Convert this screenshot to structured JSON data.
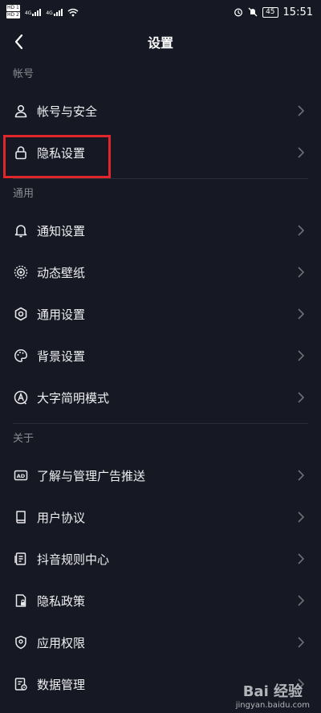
{
  "status_bar": {
    "left_badges": [
      "HD 1",
      "HD 2"
    ],
    "net_labels": [
      "4G",
      "4G"
    ],
    "battery": "45",
    "time": "15:51"
  },
  "header": {
    "title": "设置"
  },
  "sections": {
    "account": {
      "label": "帐号",
      "items": [
        {
          "label": "帐号与安全",
          "icon": "user-icon"
        },
        {
          "label": "隐私设置",
          "icon": "lock-icon"
        }
      ]
    },
    "general": {
      "label": "通用",
      "items": [
        {
          "label": "通知设置",
          "icon": "bell-icon"
        },
        {
          "label": "动态壁纸",
          "icon": "live-wallpaper-icon"
        },
        {
          "label": "通用设置",
          "icon": "gear-icon"
        },
        {
          "label": "背景设置",
          "icon": "palette-icon"
        },
        {
          "label": "大字简明模式",
          "icon": "large-font-icon"
        }
      ]
    },
    "about": {
      "label": "关于",
      "items": [
        {
          "label": "了解与管理广告推送",
          "icon": "ad-icon"
        },
        {
          "label": "用户协议",
          "icon": "book-icon"
        },
        {
          "label": "抖音规则中心",
          "icon": "document-list-icon"
        },
        {
          "label": "隐私政策",
          "icon": "privacy-doc-icon"
        },
        {
          "label": "应用权限",
          "icon": "shield-icon"
        },
        {
          "label": "数据管理",
          "icon": "data-manage-icon"
        }
      ]
    }
  },
  "watermark": {
    "brand": "Bai 经验",
    "url": "jingyan.baidu.com"
  },
  "colors": {
    "background": "#161823",
    "highlight": "#e0262b",
    "secondary_text": "#8a8b91"
  }
}
